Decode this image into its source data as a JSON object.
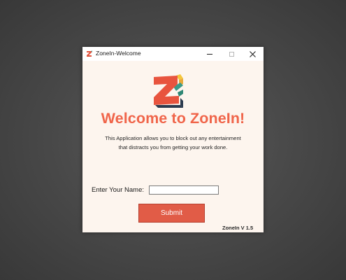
{
  "window": {
    "title": "ZoneIn-Welcome",
    "controls": {
      "minimize": "minimize-icon",
      "maximize": "maximize-icon",
      "close": "close-icon"
    }
  },
  "main": {
    "heading": "Welcome to ZoneIn!",
    "description_line1": "This Application allows you to block out any entertainment",
    "description_line2": "that distracts you from getting your work done.",
    "name_label": "Enter Your Name:",
    "name_value": "",
    "submit_label": "Submit",
    "version": "ZoneIn V 1.5"
  },
  "colors": {
    "background": "#fdf5ee",
    "accent": "#f0654a",
    "button": "#e15c47",
    "logo_teal": "#3a9a88",
    "logo_yellow": "#f4c63a",
    "logo_navy": "#2b3a4e"
  }
}
